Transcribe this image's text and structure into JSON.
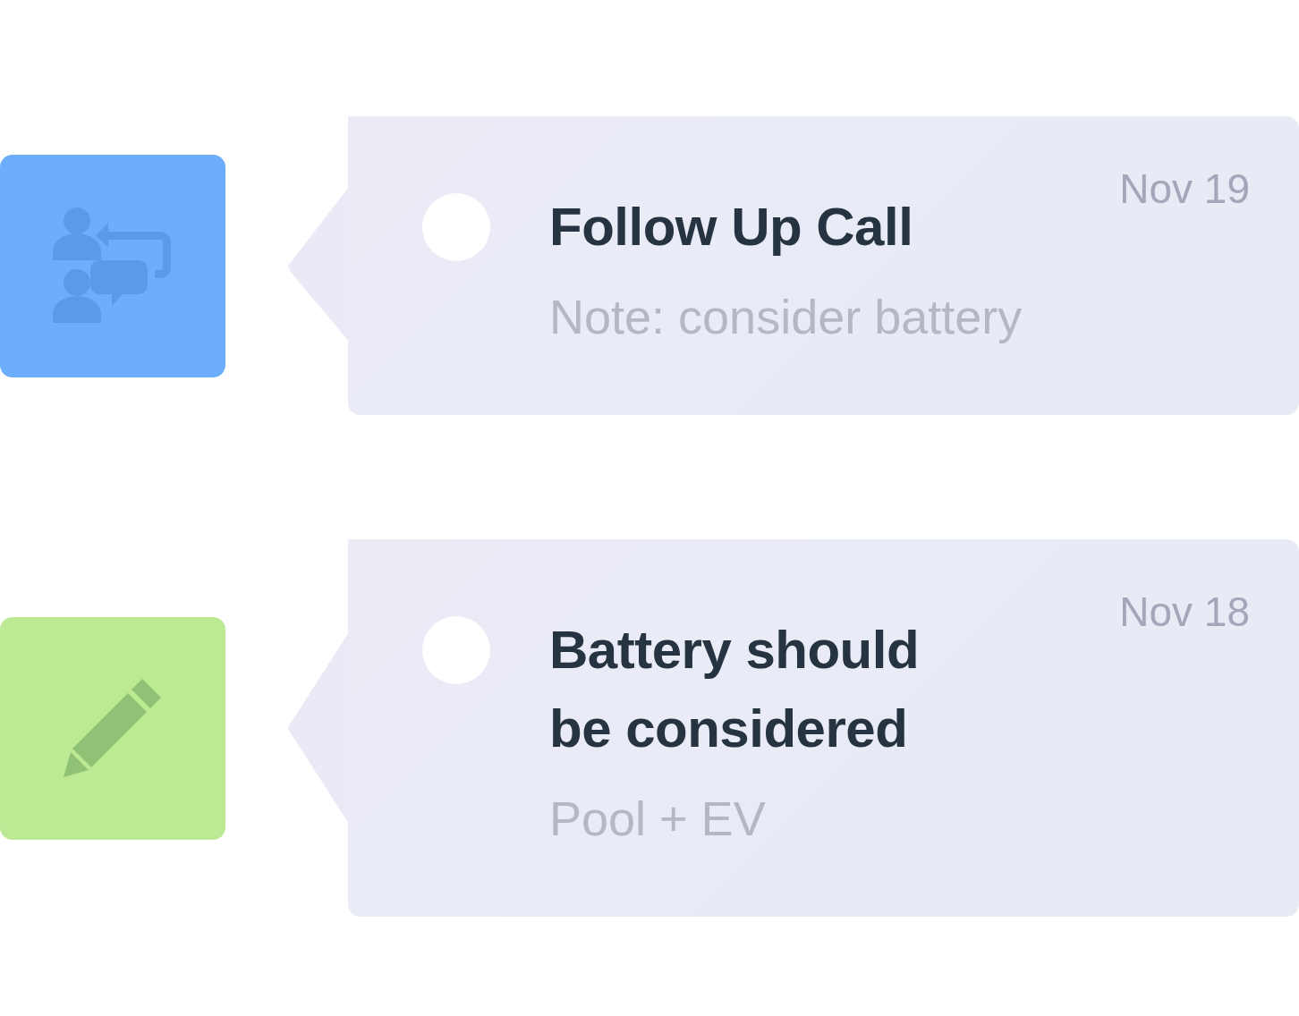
{
  "entries": [
    {
      "kind": "call",
      "color": "#6daefc",
      "completed": false,
      "date": "Nov 19",
      "title": "Follow Up Call",
      "note": "Note: consider battery"
    },
    {
      "kind": "note",
      "color": "#bde995",
      "completed": false,
      "date": "Nov 18",
      "title": "Battery should be considered",
      "note": "Pool + EV"
    }
  ]
}
